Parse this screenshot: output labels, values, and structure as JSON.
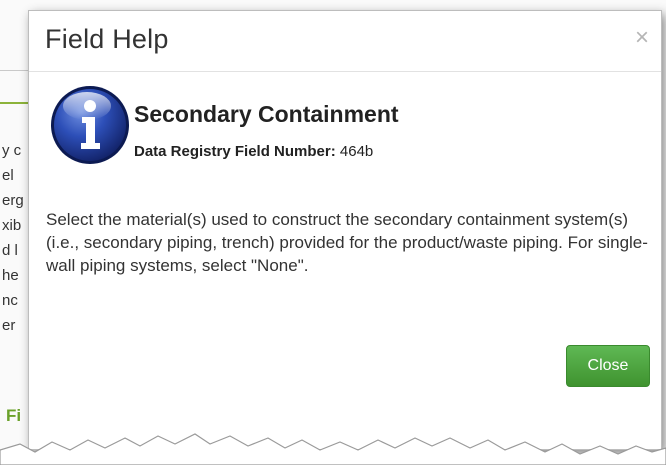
{
  "background": {
    "fragments": [
      "y c",
      "el",
      "erg",
      "xib",
      "d l",
      "he",
      "nc",
      "er"
    ],
    "green_label": "Fi"
  },
  "dialog": {
    "title": "Field Help",
    "close_glyph": "×",
    "field_name": "Secondary Containment",
    "registry_label": "Data Registry Field Number:",
    "registry_value": "464b",
    "help_text": "Select the material(s) used to construct the secondary containment system(s) (i.e., secondary piping, trench) provided for the product/waste piping. For single-wall piping systems, select \"None\".",
    "close_button": "Close",
    "icon": "info-icon",
    "accent_color": "#4a9e3c",
    "icon_color": "#1f3a8a"
  }
}
